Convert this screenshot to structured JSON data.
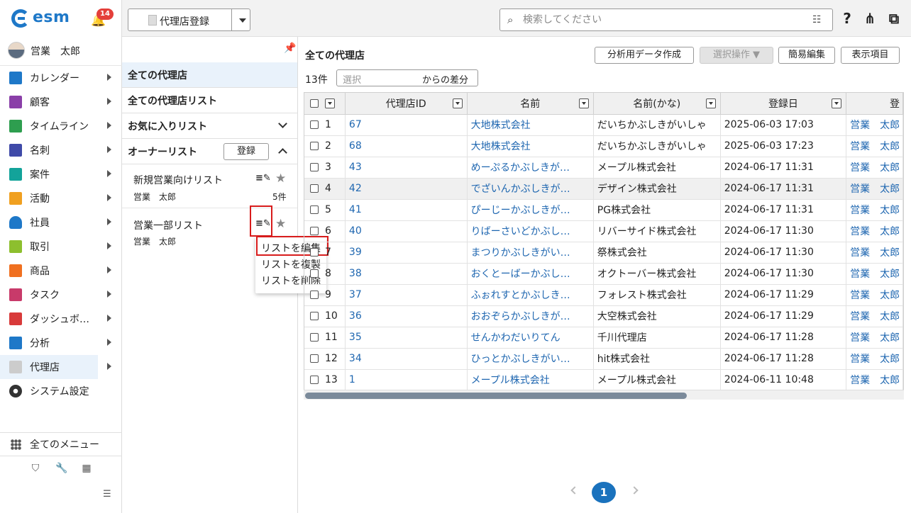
{
  "app": {
    "logo": "esm",
    "notifications": "14"
  },
  "user": {
    "name": "営業　太郎"
  },
  "sidebar": {
    "items": [
      {
        "label": "カレンダー",
        "icon": "calendar-icon",
        "color": "#1e78c8"
      },
      {
        "label": "顧客",
        "icon": "building-icon",
        "color": "#8a3fa8"
      },
      {
        "label": "タイムライン",
        "icon": "chat-icon",
        "color": "#2e9e4f"
      },
      {
        "label": "名刺",
        "icon": "card-icon",
        "color": "#3f4aa8"
      },
      {
        "label": "案件",
        "icon": "folder-icon",
        "color": "#13a39a"
      },
      {
        "label": "活動",
        "icon": "note-icon",
        "color": "#f0a020"
      },
      {
        "label": "社員",
        "icon": "person-icon",
        "color": "#1e78c8"
      },
      {
        "label": "取引",
        "icon": "deal-icon",
        "color": "#8dbf2e"
      },
      {
        "label": "商品",
        "icon": "box-icon",
        "color": "#f07020"
      },
      {
        "label": "タスク",
        "icon": "task-icon",
        "color": "#c83a6a"
      },
      {
        "label": "ダッシュボ…",
        "icon": "dashboard-icon",
        "color": "#d83a3a"
      },
      {
        "label": "分析",
        "icon": "chart-icon",
        "color": "#1e78c8"
      },
      {
        "label": "代理店",
        "icon": "doc-icon",
        "color": "#cccccc"
      },
      {
        "label": "システム設定",
        "icon": "gear-icon",
        "color": "#333333"
      }
    ],
    "all_menu": "全てのメニュー"
  },
  "topbar": {
    "view_label": "代理店登録",
    "search_placeholder": "検索してください"
  },
  "listpanel": {
    "all_agents": "全ての代理店",
    "all_lists": "全ての代理店リスト",
    "favorites": "お気に入りリスト",
    "owner_lists": "オーナーリスト",
    "register": "登録",
    "lists": [
      {
        "title": "新規営業向けリスト",
        "owner": "営業　太郎",
        "count": "5件"
      },
      {
        "title": "営業一部リスト",
        "owner": "営業　太郎",
        "count": ""
      }
    ],
    "context_menu": [
      "リストを編集",
      "リストを複製",
      "リストを削除"
    ]
  },
  "main": {
    "title": "全ての代理店",
    "buttons": {
      "analysis": "分析用データ作成",
      "selection": "選択操作 ▼",
      "quick_edit": "簡易編集",
      "display_items": "表示項目"
    },
    "count": "13件",
    "diff_placeholder": "選択",
    "diff_suffix": "からの差分",
    "columns": [
      "代理店ID",
      "名前",
      "名前(かな)",
      "登録日",
      "登"
    ],
    "rows": [
      {
        "n": "1",
        "id": "67",
        "name": "大地株式会社",
        "kana": "だいちかぶしきがいしゃ",
        "date": "2025-06-03 17:03",
        "user": "営業　太郎"
      },
      {
        "n": "2",
        "id": "68",
        "name": "大地株式会社",
        "kana": "だいちかぶしきがいしゃ",
        "date": "2025-06-03 17:23",
        "user": "営業　太郎"
      },
      {
        "n": "3",
        "id": "43",
        "name": "めーぷるかぶしきが…",
        "kana": "メープル株式会社",
        "date": "2024-06-17 11:31",
        "user": "営業　太郎"
      },
      {
        "n": "4",
        "id": "42",
        "name": "でざいんかぶしきが…",
        "kana": "デザイン株式会社",
        "date": "2024-06-17 11:31",
        "user": "営業　太郎"
      },
      {
        "n": "5",
        "id": "41",
        "name": "ぴーじーかぶしきが…",
        "kana": "PG株式会社",
        "date": "2024-06-17 11:31",
        "user": "営業　太郎"
      },
      {
        "n": "6",
        "id": "40",
        "name": "りばーさいどかぶし…",
        "kana": "リバーサイド株式会社",
        "date": "2024-06-17 11:30",
        "user": "営業　太郎"
      },
      {
        "n": "7",
        "id": "39",
        "name": "まつりかぶしきがい…",
        "kana": "祭株式会社",
        "date": "2024-06-17 11:30",
        "user": "営業　太郎"
      },
      {
        "n": "8",
        "id": "38",
        "name": "おくとーばーかぶし…",
        "kana": "オクトーバー株式会社",
        "date": "2024-06-17 11:30",
        "user": "営業　太郎"
      },
      {
        "n": "9",
        "id": "37",
        "name": "ふぉれすとかぶしき…",
        "kana": "フォレスト株式会社",
        "date": "2024-06-17 11:29",
        "user": "営業　太郎"
      },
      {
        "n": "10",
        "id": "36",
        "name": "おおぞらかぶしきが…",
        "kana": "大空株式会社",
        "date": "2024-06-17 11:29",
        "user": "営業　太郎"
      },
      {
        "n": "11",
        "id": "35",
        "name": "せんかわだいりてん",
        "kana": "千川代理店",
        "date": "2024-06-17 11:28",
        "user": "営業　太郎"
      },
      {
        "n": "12",
        "id": "34",
        "name": "ひっとかぶしきがい…",
        "kana": "hit株式会社",
        "date": "2024-06-17 11:28",
        "user": "営業　太郎"
      },
      {
        "n": "13",
        "id": "1",
        "name": "メープル株式会社",
        "kana": "メープル株式会社",
        "date": "2024-06-11 10:48",
        "user": "営業　太郎"
      }
    ],
    "page": "1"
  }
}
